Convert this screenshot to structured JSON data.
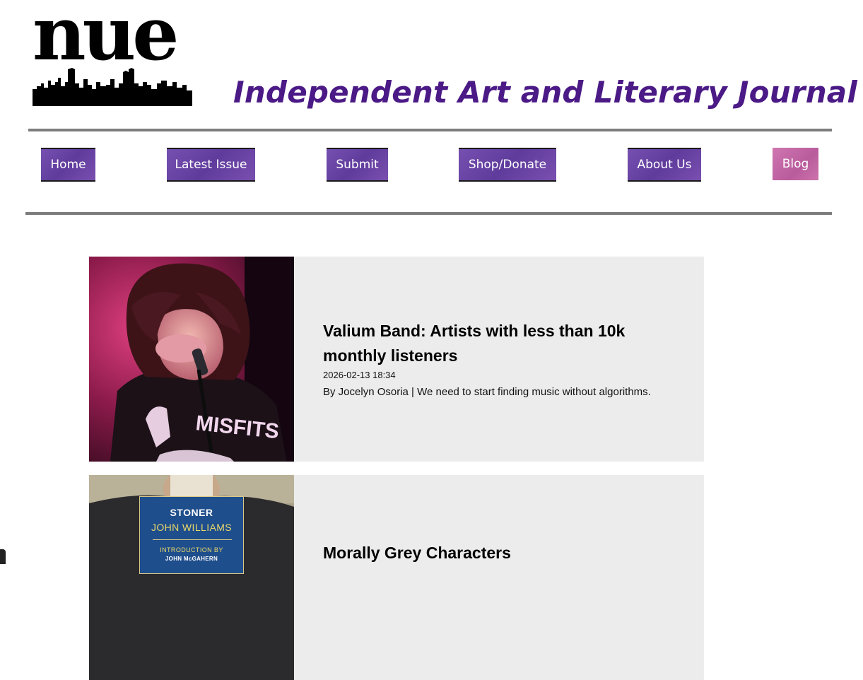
{
  "site": {
    "logo_text": "nue",
    "tagline": "Independent Art and Literary Journal"
  },
  "nav": {
    "items": [
      {
        "label": "Home"
      },
      {
        "label": "Latest Issue"
      },
      {
        "label": "Submit"
      },
      {
        "label": "Shop/Donate"
      },
      {
        "label": "About Us"
      },
      {
        "label": "Blog"
      }
    ]
  },
  "posts": [
    {
      "title": "Valium Band: Artists with less than 10k monthly listeners",
      "date": "2026-02-13 18:34",
      "excerpt": "By Jocelyn Osoria | We need to start finding music without algorithms.",
      "image_shirt_text": "MISFITS"
    },
    {
      "title": "Morally Grey Characters",
      "book_cover": {
        "title": "STONER",
        "author": "JOHN WILLIAMS",
        "intro": "INTRODUCTION BY",
        "intro_name": "JOHN McGAHERN"
      }
    }
  ],
  "colors": {
    "tagline": "#4b1a86",
    "nav_button": "#6a45a5",
    "blog_button": "#c46aa6",
    "card_background": "#ececec",
    "rule": "#7d7d7d"
  }
}
